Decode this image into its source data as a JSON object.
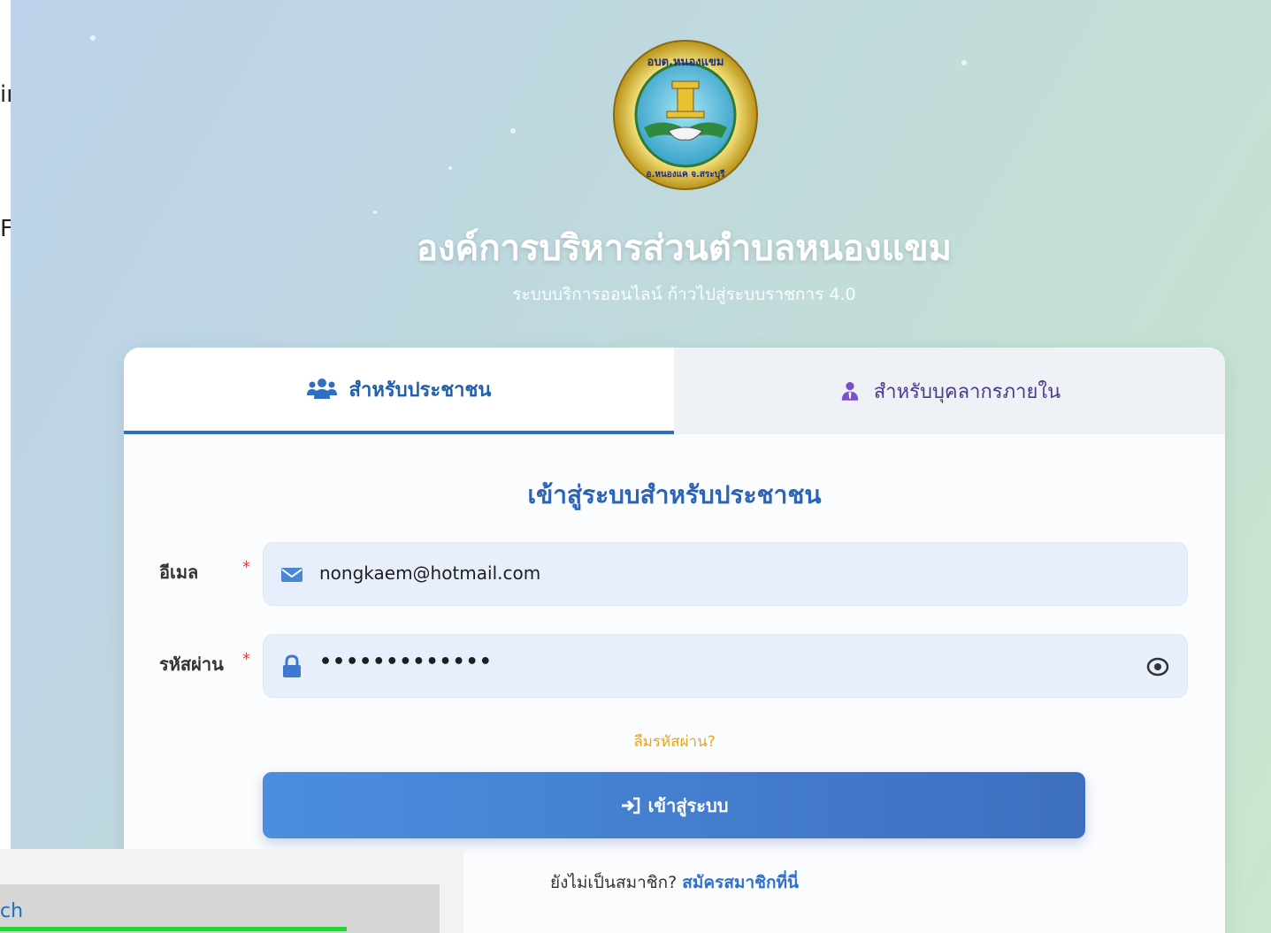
{
  "background_fragments": {
    "line1": "in)",
    "line2": "FA"
  },
  "header": {
    "org_title": "องค์การบริหารส่วนตำบลหนองแขม",
    "org_subtitle": "ระบบบริการออนไลน์ ก้าวไปสู่ระบบราชการ 4.0",
    "logo_text_top": "อบต.หนองแขม",
    "logo_text_bottom": "อ.หนองแค จ.สระบุรี"
  },
  "tabs": [
    {
      "label": "สำหรับประชาชน",
      "icon": "users-icon",
      "active": true
    },
    {
      "label": "สำหรับบุคลากรภายใน",
      "icon": "user-tie-icon",
      "active": false
    }
  ],
  "form": {
    "title": "เข้าสู่ระบบสำหรับประชาชน",
    "email_label": "อีเมล",
    "email_value": "nongkaem@hotmail.com",
    "password_label": "รหัสผ่าน",
    "password_value": "•••••••••••••",
    "required_mark": "*",
    "forgot_link": "ลืมรหัสผ่าน?",
    "login_button": "เข้าสู่ระบบ",
    "register_prompt": "ยังไม่เป็นสมาชิก?",
    "register_link": "สมัครสมาชิกที่นี่"
  },
  "overlay": {
    "text": "ch"
  },
  "colors": {
    "primary": "#2a63b8",
    "tab_active_border": "#2f6fc0",
    "forgot": "#e3a52a",
    "required": "#e0403a",
    "field_bg": "#e8effc"
  }
}
